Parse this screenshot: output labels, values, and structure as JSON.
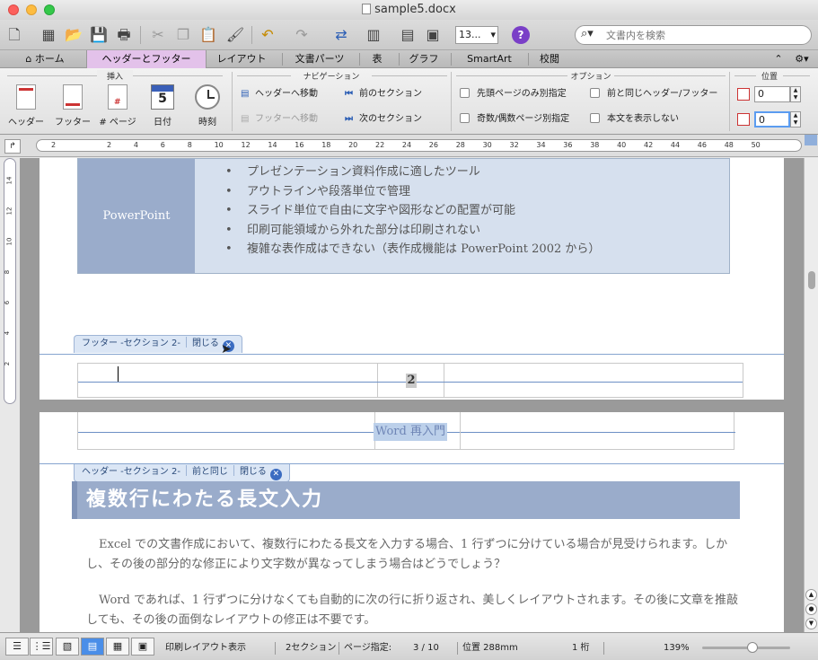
{
  "window": {
    "title": "sample5.docx"
  },
  "toolbar": {
    "zoom_value": "13...",
    "search_placeholder": "文書内を検索"
  },
  "tabs": [
    {
      "label": "ホーム"
    },
    {
      "label": "ヘッダーとフッター"
    },
    {
      "label": "レイアウト"
    },
    {
      "label": "文書パーツ"
    },
    {
      "label": "表"
    },
    {
      "label": "グラフ"
    },
    {
      "label": "SmartArt"
    },
    {
      "label": "校閲"
    }
  ],
  "ribbon": {
    "groups": {
      "insert": "挿入",
      "navigation": "ナビゲーション",
      "options": "オプション",
      "position": "位置"
    },
    "insert_buttons": {
      "header": "ヘッダー",
      "footer": "フッター",
      "page_number": "# ページ",
      "date": "日付",
      "time": "時刻",
      "calendar_day": "5"
    },
    "nav": {
      "go_header": "ヘッダーへ移動",
      "go_footer": "フッターへ移動",
      "prev_section": "前のセクション",
      "next_section": "次のセクション"
    },
    "options": {
      "first_page": "先頭ページのみ別指定",
      "odd_even": "奇数/偶数ページ別指定",
      "same_as_prev": "前と同じヘッダー/フッター",
      "hide_body": "本文を表示しない"
    },
    "position": {
      "header_from_top": "0",
      "footer_from_bottom": "0"
    }
  },
  "ruler": {
    "ticks": [
      "2",
      "2",
      "4",
      "6",
      "8",
      "10",
      "12",
      "14",
      "16",
      "18",
      "20",
      "22",
      "24",
      "26",
      "28",
      "30",
      "32",
      "34",
      "36",
      "38",
      "40",
      "42",
      "44",
      "46",
      "48",
      "50"
    ],
    "vticks": [
      "14",
      "12",
      "10",
      "8",
      "6",
      "4",
      "2"
    ]
  },
  "document": {
    "table": {
      "label": "PowerPoint",
      "bullets": [
        "プレゼンテーション資料作成に適したツール",
        "アウトラインや段落単位で管理",
        "スライド単位で自由に文字や図形などの配置が可能",
        "印刷可能領域から外れた部分は印刷されない",
        "複雑な表作成はできない（表作成機能は PowerPoint 2002 から）"
      ]
    },
    "footer_tag": {
      "label": "フッター -セクション 2-",
      "close": "閉じる"
    },
    "page_number": "2",
    "header_text": "Word 再入門",
    "header_tag": {
      "label": "ヘッダー -セクション 2-",
      "same_as_prev": "前と同じ",
      "close": "閉じる"
    },
    "heading": "複数行にわたる長文入力",
    "paragraphs": [
      "Excel での文書作成において、複数行にわたる長文を入力する場合、1 行ずつに分けている場合が見受けられます。しかし、その後の部分的な修正により文字数が異なってしまう場合はどうでしょう？",
      "Word であれば、1 行ずつに分けなくても自動的に次の行に折り返され、美しくレイアウトされます。その後に文章を推敲しても、その後の面倒なレイアウトの修正は不要です。"
    ]
  },
  "status": {
    "view_mode": "印刷レイアウト表示",
    "sections": "2セクション",
    "page_label": "ページ指定:",
    "page_value": "3 / 10",
    "position": "位置 288mm",
    "column": "1 桁",
    "zoom": "139%"
  }
}
